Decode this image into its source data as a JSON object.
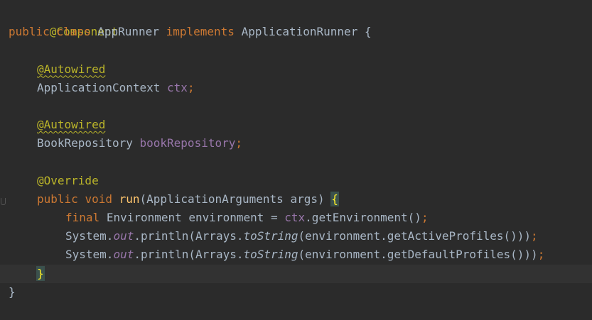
{
  "editor": {
    "colors": {
      "background": "#2b2b2b",
      "keyword": "#cc7832",
      "annotation": "#bbb529",
      "field": "#9876aa",
      "method": "#ffc66d",
      "text": "#a9b7c6"
    },
    "lines": {
      "l1": {
        "component": "@Component"
      },
      "l2": {
        "public": "public",
        "class": "class",
        "name": "AppRunner",
        "implements": "implements",
        "iface": "ApplicationRunner",
        "brace": "{"
      },
      "l4": {
        "autowired": "@Autowired"
      },
      "l5": {
        "type": "ApplicationContext",
        "var": "ctx",
        "semi": ";"
      },
      "l7": {
        "autowired": "@Autowired"
      },
      "l8": {
        "type": "BookRepository",
        "var": "bookRepository",
        "semi": ";"
      },
      "l10": {
        "override": "@Override"
      },
      "l11": {
        "public": "public",
        "void": "void",
        "method": "run",
        "params": "(ApplicationArguments args) ",
        "brace": "{"
      },
      "l12": {
        "final": "final",
        "rest1": "Environment environment = ",
        "ctx": "ctx",
        "rest2": ".getEnvironment()",
        "semi": ";"
      },
      "l13": {
        "system": "System.",
        "out": "out",
        "mid": ".println(Arrays.",
        "tostring": "toString",
        "end": "(environment.getActiveProfiles()))",
        "semi": ";"
      },
      "l14": {
        "system": "System.",
        "out": "out",
        "mid": ".println(Arrays.",
        "tostring": "toString",
        "end": "(environment.getDefaultProfiles()))",
        "semi": ";"
      },
      "l15": {
        "brace": "}"
      },
      "l16": {
        "brace": "}"
      }
    }
  }
}
